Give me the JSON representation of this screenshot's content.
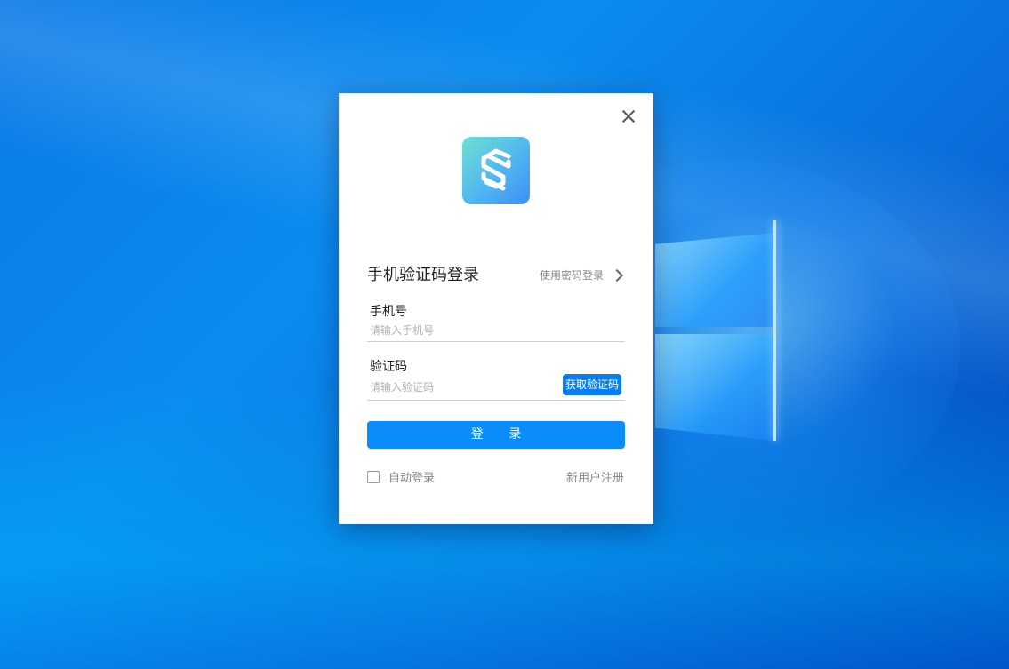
{
  "dialog": {
    "title": "手机验证码登录",
    "switch_mode_label": "使用密码登录",
    "phone": {
      "label": "手机号",
      "placeholder": "请输入手机号",
      "value": ""
    },
    "code": {
      "label": "验证码",
      "placeholder": "请输入验证码",
      "value": "",
      "get_code_label": "获取验证码"
    },
    "login_label": "登 录",
    "auto_login_label": "自动登录",
    "auto_login_checked": false,
    "register_label": "新用户注册"
  },
  "icons": {
    "close": "close-icon",
    "logo": "app-logo-icon",
    "chevron": "chevron-right-icon"
  },
  "colors": {
    "accent": "#0a8cfa",
    "get_code_button": "#0a7ef0",
    "logo_gradient_start": "#6ee0d2",
    "logo_gradient_end": "#3f8ef5"
  }
}
